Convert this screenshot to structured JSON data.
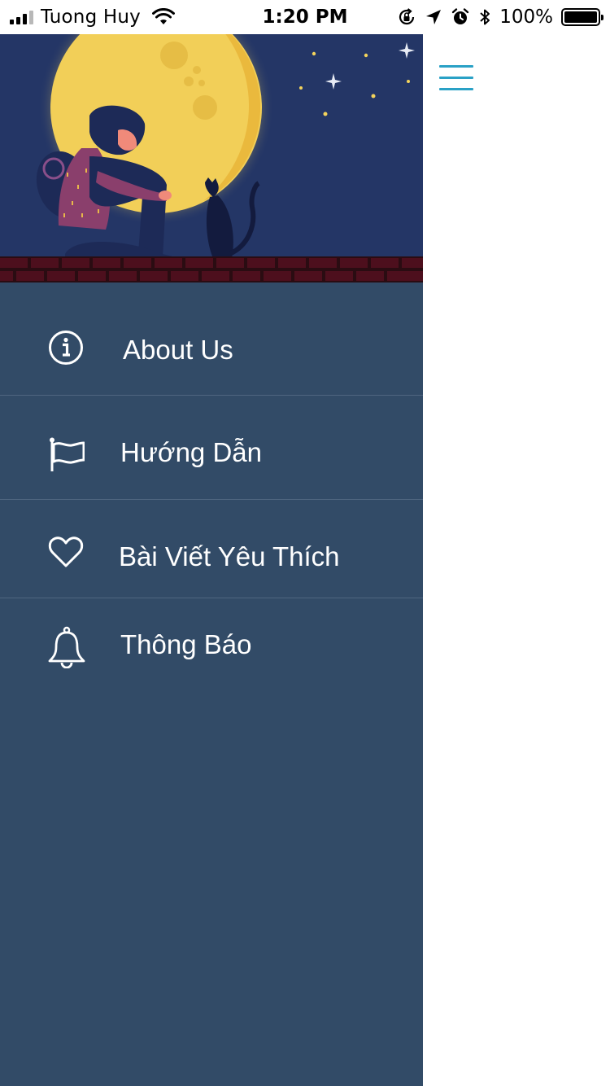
{
  "status_bar": {
    "carrier": "Tuong Huy",
    "time": "1:20 PM",
    "battery_percent": "100%",
    "battery_level": 1.0,
    "icons": [
      "signal-icon",
      "wifi-icon",
      "rotation-lock-icon",
      "location-arrow-icon",
      "alarm-icon",
      "bluetooth-icon",
      "battery-icon"
    ]
  },
  "drawer": {
    "background": "#324b67",
    "hero_image": "girl-and-cat-under-full-moon",
    "menu": [
      {
        "label": "About Us",
        "icon": "info-icon"
      },
      {
        "label": "Hướng Dẫn",
        "icon": "flag-icon"
      },
      {
        "label": "Bài Viết Yêu Thích",
        "icon": "heart-icon"
      },
      {
        "label": "Thông Báo",
        "icon": "bell-icon"
      }
    ]
  },
  "header": {
    "menu_button_icon": "hamburger-menu-icon",
    "accent": "#2aa1c6"
  }
}
